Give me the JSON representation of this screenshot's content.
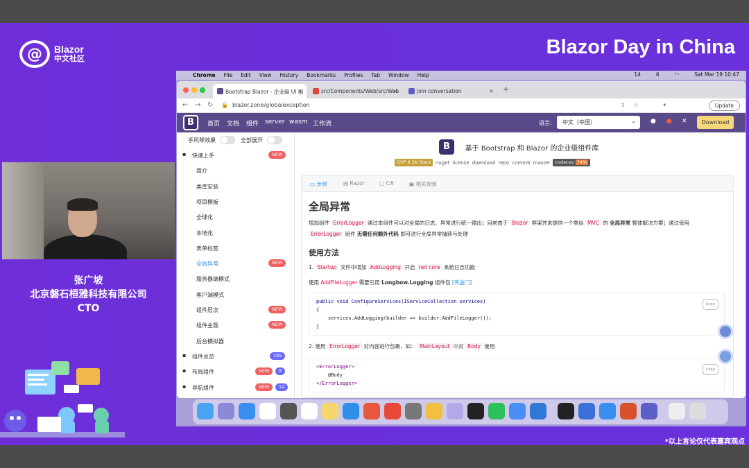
{
  "slide": {
    "event_title": "Blazor Day in China",
    "logo_line1": "Blazor",
    "logo_line2": "中文社区",
    "speaker_name": "张广坡",
    "speaker_company": "北京磐石桓雅科技有限公司",
    "speaker_title": "CTO",
    "disclaimer": "*以上言论仅代表嘉宾观点"
  },
  "mac_menubar": {
    "app": "Chrome",
    "items": [
      "File",
      "Edit",
      "View",
      "History",
      "Bookmarks",
      "Profiles",
      "Tab",
      "Window",
      "Help"
    ],
    "clock": "Sat Mar 19  10:47",
    "status_numbers": [
      "14",
      "6"
    ]
  },
  "browser": {
    "tabs": [
      {
        "title": "Bootstrap Blazor - 企业级 UI 组",
        "active": true
      },
      {
        "title": "src/Components/Web/src/Web",
        "active": false
      },
      {
        "title": "Join conversation",
        "active": false
      }
    ],
    "url": "blazor.zone/globalexception",
    "update_label": "Update"
  },
  "site": {
    "nav": [
      "首页",
      "文档",
      "组件",
      "server",
      "wasm",
      "工作流"
    ],
    "lang_label": "语言:",
    "lang_value": "中文（中国）",
    "download_label": "Download",
    "sidebar_toggles": [
      "手风琴效果",
      "全部展开"
    ],
    "sidebar": [
      {
        "label": "快速上手",
        "top": true,
        "badge": "NEW"
      },
      {
        "label": "简介"
      },
      {
        "label": "类库安装"
      },
      {
        "label": "项目模板"
      },
      {
        "label": "全球化"
      },
      {
        "label": "本地化"
      },
      {
        "label": "表单标签"
      },
      {
        "label": "全局异常",
        "active": true,
        "badge": "NEW"
      },
      {
        "label": "服务器端模式"
      },
      {
        "label": "客户端模式"
      },
      {
        "label": "组件层次",
        "badge": "NEW"
      },
      {
        "label": "组件主题",
        "badge": "NEW"
      },
      {
        "label": "后台模拟器"
      },
      {
        "label": "组件总览",
        "top": true,
        "badge2": "105"
      },
      {
        "label": "布局组件",
        "top": true,
        "badge": "NEW",
        "badge2": "8"
      },
      {
        "label": "导航组件",
        "top": true,
        "badge": "NEW",
        "badge2": "12"
      }
    ],
    "hero_title": "基于 Bootstrap 和 Blazor 的企业级组件库",
    "shields": {
      "gvp": "GVP",
      "stars": "6.3K Stars",
      "links": [
        "nuget",
        "license",
        "download",
        "repo",
        "commit",
        "master"
      ],
      "codecov": "codecov",
      "codecov_value": "74%"
    },
    "card_tabs": [
      "示例",
      "Razor",
      "C#",
      "相关视频"
    ],
    "page_heading": "全局异常",
    "intro": {
      "p1": "增加组件",
      "c1": "ErrorLogger",
      "p2": "通过本组件可以对全局的日志、异常进行统一输出；目前由于",
      "c2": "Blazor",
      "p3": "框架并未提供一个类似",
      "c3": "MVC",
      "p4": "的",
      "b1": "全局异常",
      "p5": "整体解决方案；通过使用",
      "c4": "ErrorLogger",
      "p6": "组件",
      "b2": "无需任何额外代码",
      "p7": "即可进行全局异常捕获与处理"
    },
    "usage_heading": "使用方法",
    "step1": {
      "n": "1.",
      "c1": "Startup",
      "t1": "文件中增加",
      "c2": "AddLogging",
      "t2": "开启",
      "c3": "net core",
      "t3": "系统日志功能"
    },
    "step1b": {
      "t1": "使用",
      "c1": "AddFileLogger",
      "t2": "需要引用",
      "b1": "Longbow.Logging",
      "t3": "组件包",
      "link": "[传送门]"
    },
    "code1": [
      "public void ConfigureServices(IServiceCollection services)",
      "{",
      "    services.AddLogging(builder => builder.AddFileLogger());",
      "}"
    ],
    "step2": {
      "n": "2.",
      "t0": "使用",
      "c1": "ErrorLogger",
      "t1": "对内容进行包裹，如：",
      "c2": "MainLayout",
      "t2": "中对",
      "c3": "Body",
      "t3": "使用"
    },
    "code2": [
      "<ErrorLogger>",
      "    @Body",
      "</ErrorLogger>"
    ],
    "copy_label": "Copy"
  }
}
